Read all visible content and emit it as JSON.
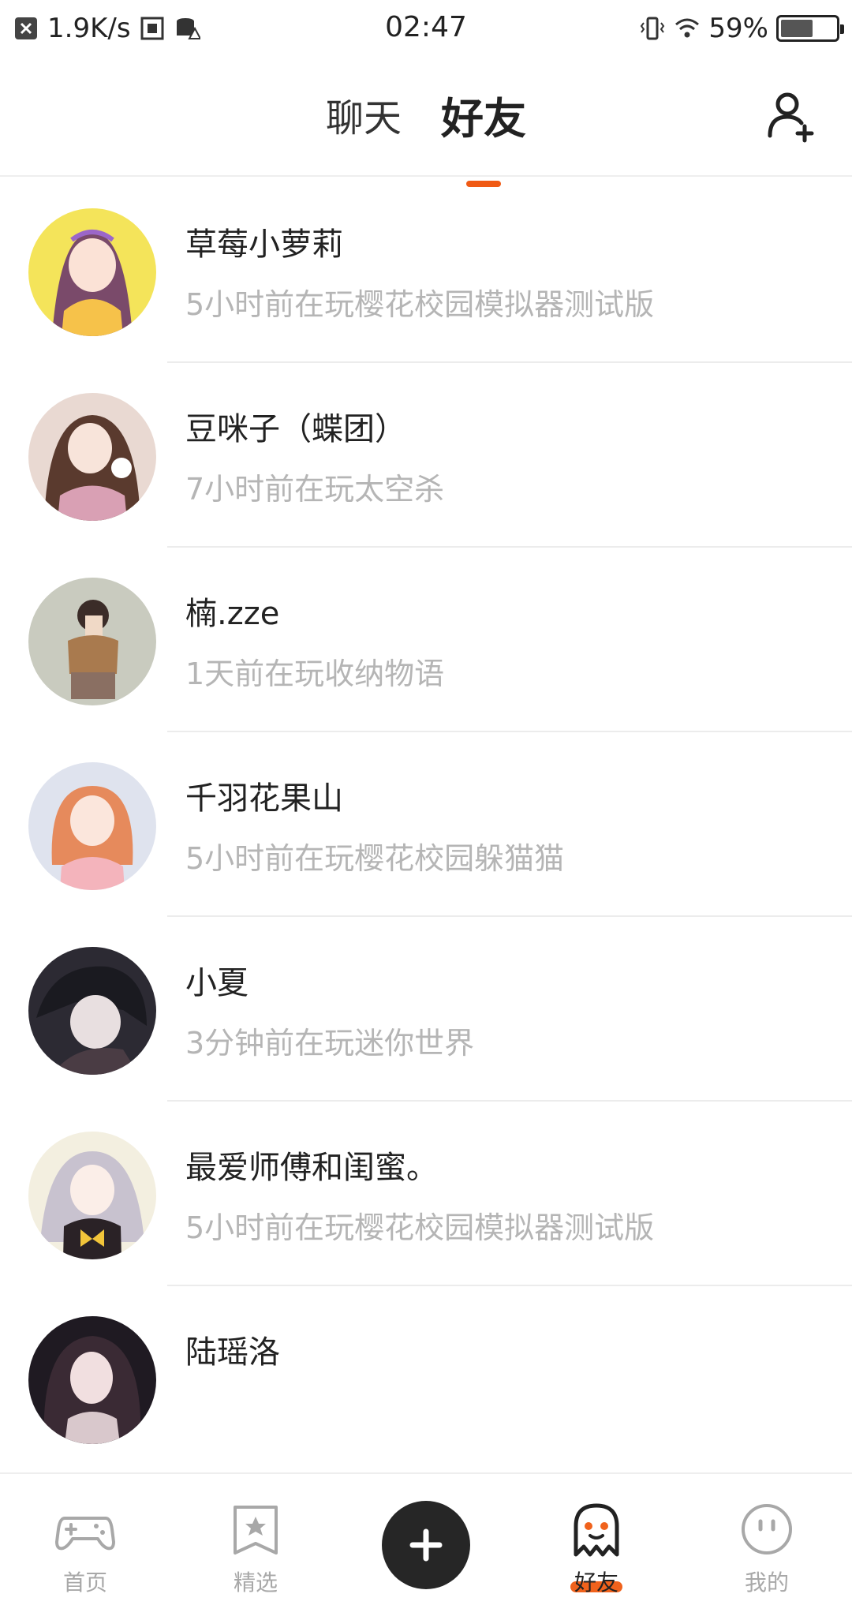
{
  "status_bar": {
    "net_speed": "1.9K/s",
    "time": "02:47",
    "battery": "59%",
    "battery_level": 0.59
  },
  "header": {
    "tabs": [
      {
        "label": "聊天",
        "active": false
      },
      {
        "label": "好友",
        "active": true
      }
    ],
    "add_friend_icon": "person-add-icon",
    "accent_color": "#f05a14"
  },
  "friends": [
    {
      "name": "草莓小萝莉",
      "activity": "5小时前在玩樱花校园模拟器测试版"
    },
    {
      "name": "豆咪子（蝶团）",
      "activity": "7小时前在玩太空杀"
    },
    {
      "name": "楠.zze",
      "activity": "1天前在玩收纳物语"
    },
    {
      "name": "千羽花果山",
      "activity": "5小时前在玩樱花校园躲猫猫"
    },
    {
      "name": "小夏",
      "activity": "3分钟前在玩迷你世界"
    },
    {
      "name": "最爱师傅和闺蜜。",
      "activity": "5小时前在玩樱花校园模拟器测试版"
    },
    {
      "name": "陆瑶洛",
      "activity": ""
    }
  ],
  "bottom_nav": {
    "items": [
      {
        "label": "首页",
        "icon": "gamepad-icon"
      },
      {
        "label": "精选",
        "icon": "star-bookmark-icon"
      },
      {
        "label": "",
        "icon": "plus-icon"
      },
      {
        "label": "好友",
        "icon": "ghost-icon",
        "active": true
      },
      {
        "label": "我的",
        "icon": "smiley-face-icon"
      }
    ]
  }
}
